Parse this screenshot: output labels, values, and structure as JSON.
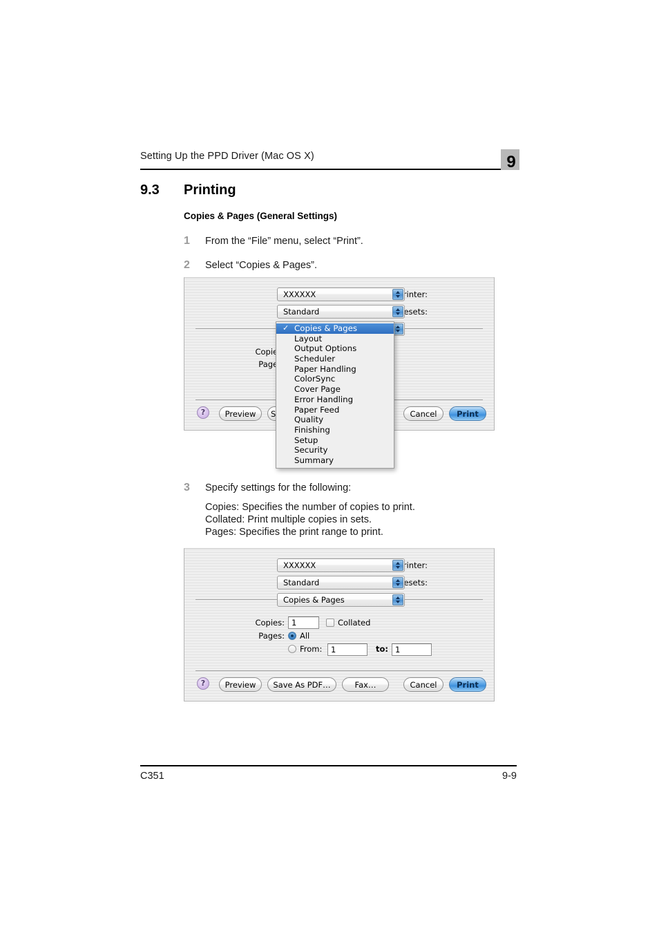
{
  "header": {
    "title": "Setting Up the PPD Driver (Mac OS X)",
    "chapter_badge": "9"
  },
  "section": {
    "number": "9.3",
    "title": "Printing",
    "subheading": "Copies & Pages (General Settings)"
  },
  "steps": [
    {
      "num": "1",
      "text": "From the “File” menu, select “Print”."
    },
    {
      "num": "2",
      "text": "Select “Copies & Pages”."
    },
    {
      "num": "3",
      "text": "Specify settings for the following:"
    }
  ],
  "step3_details": {
    "line1": "Copies: Specifies the number of copies to print.",
    "line2": "Collated: Print multiple copies in sets.",
    "line3": "Pages: Specifies the print range to print."
  },
  "dialog1": {
    "printer_label": "Printer:",
    "printer_value": "XXXXXX",
    "presets_label": "Presets:",
    "presets_value": "Standard",
    "pane_value": "Copies & Pages",
    "copies_label": "Copies:",
    "pages_label": "Pages:",
    "help_label": "?",
    "preview_label": "Preview",
    "savepdf_label": "Sa",
    "cancel_label": "Cancel",
    "print_label": "Print"
  },
  "menu": {
    "checkmark": "✓",
    "items": [
      {
        "label": "Copies & Pages",
        "selected": true
      },
      {
        "label": "Layout",
        "selected": false
      },
      {
        "label": "Output Options",
        "selected": false
      },
      {
        "label": "Scheduler",
        "selected": false
      },
      {
        "label": "Paper Handling",
        "selected": false
      },
      {
        "label": "ColorSync",
        "selected": false
      },
      {
        "label": "Cover Page",
        "selected": false
      },
      {
        "label": "Error Handling",
        "selected": false
      },
      {
        "label": "Paper Feed",
        "selected": false
      },
      {
        "label": "Quality",
        "selected": false
      },
      {
        "label": "Finishing",
        "selected": false
      },
      {
        "label": "Setup",
        "selected": false
      },
      {
        "label": "Security",
        "selected": false
      },
      {
        "label": "Summary",
        "selected": false
      }
    ]
  },
  "dialog2": {
    "printer_label": "Printer:",
    "printer_value": "XXXXXX",
    "presets_label": "Presets:",
    "presets_value": "Standard",
    "pane_value": "Copies & Pages",
    "copies_label": "Copies:",
    "copies_value": "1",
    "collated_label": "Collated",
    "pages_label": "Pages:",
    "all_label": "All",
    "from_label": "From:",
    "from_value": "1",
    "to_label": "to:",
    "to_value": "1",
    "help_label": "?",
    "preview_label": "Preview",
    "savepdf_label": "Save As PDF…",
    "fax_label": "Fax…",
    "cancel_label": "Cancel",
    "print_label": "Print"
  },
  "footer": {
    "left": "C351",
    "right": "9-9"
  }
}
